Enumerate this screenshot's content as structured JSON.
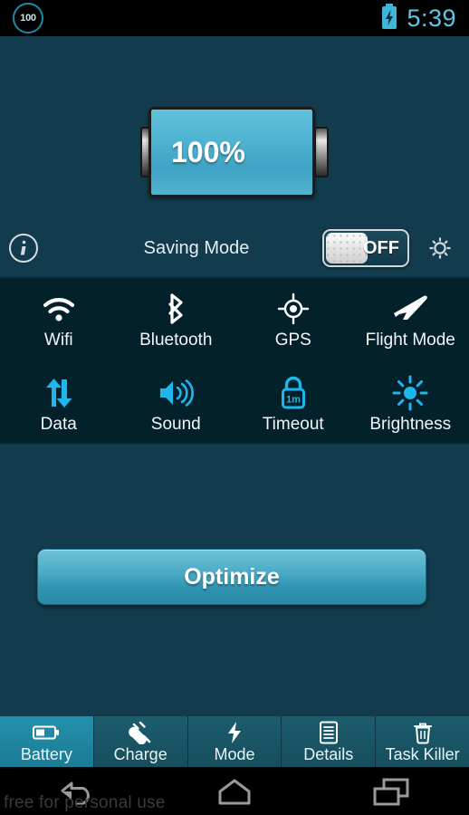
{
  "statusbar": {
    "battery_badge": "100",
    "clock": "5:39",
    "battery_icon": "battery-charging-icon"
  },
  "battery": {
    "percent_label": "100%",
    "level": 100,
    "fill_color": "#4fb4d2"
  },
  "saving_mode": {
    "info_icon": "info-icon",
    "label": "Saving Mode",
    "toggle_state": "OFF",
    "gear_icon": "gear-icon"
  },
  "quick_toggles": {
    "row1": [
      {
        "label": "Wifi",
        "icon": "wifi-icon",
        "active": false
      },
      {
        "label": "Bluetooth",
        "icon": "bluetooth-icon",
        "active": false
      },
      {
        "label": "GPS",
        "icon": "gps-icon",
        "active": false
      },
      {
        "label": "Flight Mode",
        "icon": "airplane-icon",
        "active": false
      }
    ],
    "row2": [
      {
        "label": "Data",
        "icon": "data-transfer-icon",
        "active": true
      },
      {
        "label": "Sound",
        "icon": "speaker-icon",
        "active": true
      },
      {
        "label": "Timeout",
        "icon": "lock-timeout-icon",
        "active": true,
        "value": "1m"
      },
      {
        "label": "Brightness",
        "icon": "sun-icon",
        "active": true
      }
    ],
    "active_color": "#1fb6ee",
    "inactive_color": "#ffffff"
  },
  "optimize_button": {
    "label": "Optimize"
  },
  "tabbar": {
    "tabs": [
      {
        "label": "Battery",
        "icon": "battery-icon",
        "selected": true
      },
      {
        "label": "Charge",
        "icon": "plug-icon",
        "selected": false
      },
      {
        "label": "Mode",
        "icon": "bolt-icon",
        "selected": false
      },
      {
        "label": "Details",
        "icon": "document-icon",
        "selected": false
      },
      {
        "label": "Task Killer",
        "icon": "trash-icon",
        "selected": false
      }
    ],
    "selected_color": "#2490ad"
  },
  "navbar": {
    "buttons": [
      {
        "name": "back",
        "icon": "back-arrow-icon"
      },
      {
        "name": "home",
        "icon": "home-icon"
      },
      {
        "name": "recents",
        "icon": "recents-icon"
      }
    ]
  },
  "watermark": {
    "text": "free for personal use"
  },
  "theme": {
    "panel_bg": "#123c4d",
    "toggles_bg": "#03212a",
    "accent": "#1fb6ee"
  }
}
